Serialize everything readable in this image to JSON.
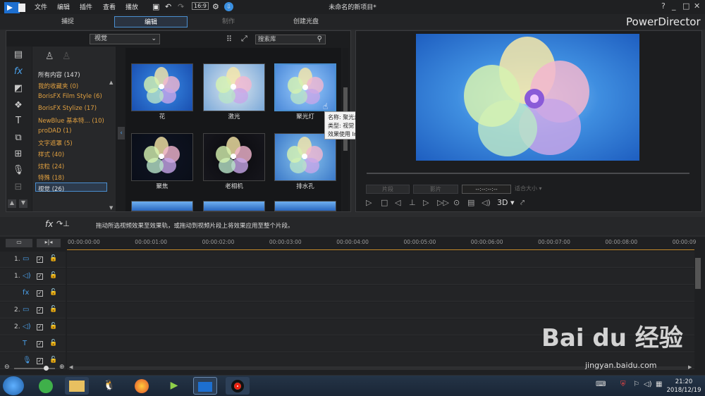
{
  "menu": [
    "文件",
    "编辑",
    "插件",
    "查看",
    "播放"
  ],
  "window_title": "未命名的新项目*",
  "window_buttons": [
    "?",
    "_",
    "□",
    "✕"
  ],
  "mode_tabs": [
    "捕捉",
    "编辑",
    "制作",
    "创建光盘"
  ],
  "brand": "PowerDirector",
  "library": {
    "dropdown": "视觉",
    "search_placeholder": "搜索库",
    "categories": [
      {
        "label": "所有内容 (147)",
        "color": "white"
      },
      {
        "label": "我的收藏夹 (0)",
        "color": "orange"
      },
      {
        "label": "BorisFX Film Style (6)",
        "color": "orange"
      },
      {
        "label": "BorisFX Stylize (17)",
        "color": "orange"
      },
      {
        "label": "NewBlue 基本特... (10)",
        "color": "orange"
      },
      {
        "label": "proDAD (1)",
        "color": "orange"
      },
      {
        "label": "文字遮罩 (5)",
        "color": "orange"
      },
      {
        "label": "样式 (40)",
        "color": "orange"
      },
      {
        "label": "炫粒 (24)",
        "color": "orange"
      },
      {
        "label": "特殊 (18)",
        "color": "orange"
      },
      {
        "label": "视觉 (26)",
        "color": "white"
      }
    ],
    "effects": [
      "花",
      "激光",
      "聚光灯",
      "聚焦",
      "老相机",
      "排水孔"
    ],
    "tooltip": [
      "名称: 聚光灯",
      "类型: 视觉",
      "效果使用 Intel 内核技术进行了改进。"
    ]
  },
  "preview": {
    "timecode": "--:--:--:--",
    "mode_3d": "3D"
  },
  "hint": "拖动所选视频效果至效果轨，或拖动到视频片段上将效果应用至整个片段。",
  "timeline": {
    "ticks": [
      "00:00:00:00",
      "00:00:01:00",
      "00:00:02:00",
      "00:00:03:00",
      "00:00:04:00",
      "00:00:05:00",
      "00:00:06:00",
      "00:00:07:00",
      "00:00:08:00",
      "00:00:09"
    ],
    "tracks": [
      "1.",
      "1.",
      "",
      "2.",
      "2.",
      "",
      ""
    ]
  },
  "taskbar": {
    "time": "21:20",
    "date": "2018/12/19"
  },
  "watermark": "Bai du 经验",
  "watermark_url": "jingyan.baidu.com"
}
